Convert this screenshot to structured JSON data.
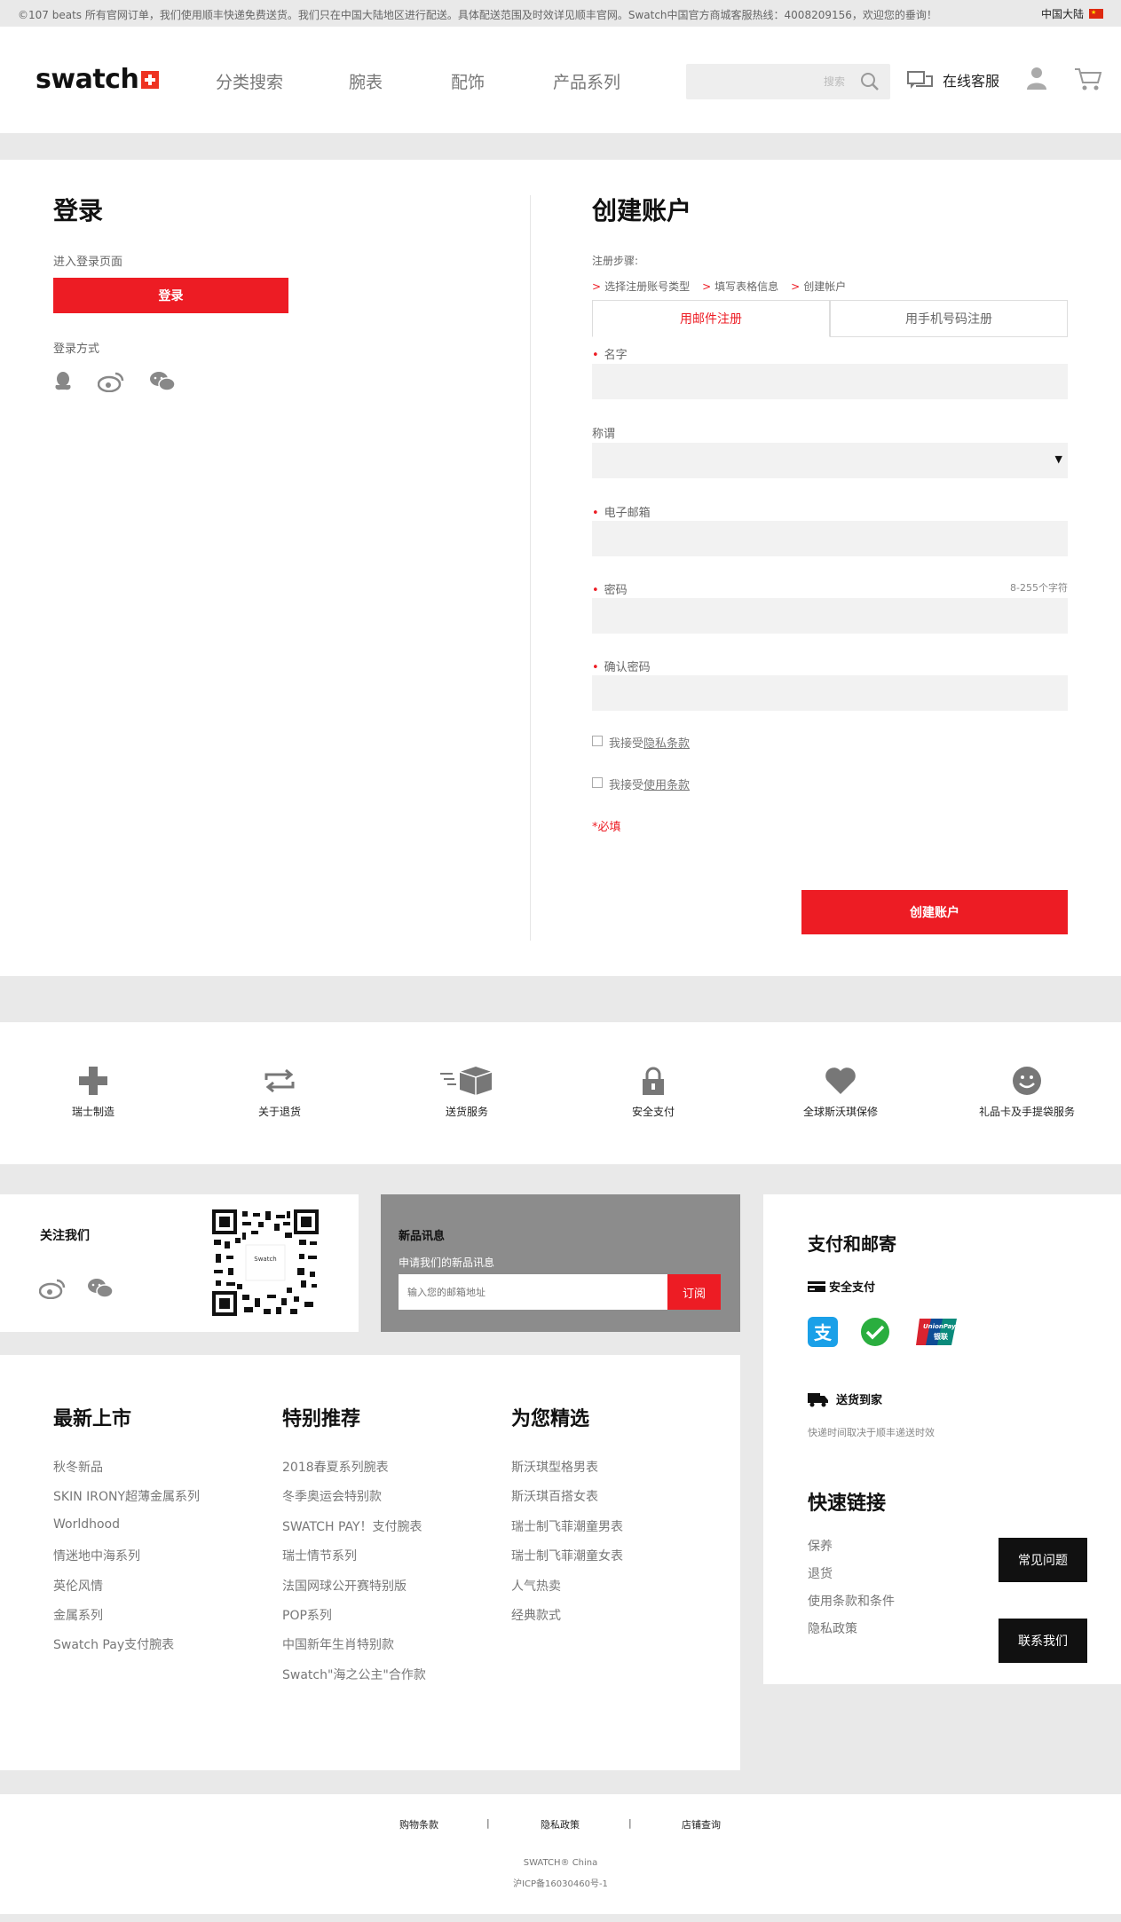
{
  "topbar": {
    "notice": "©107 beats 所有官网订单，我们使用顺丰快递免费送货。我们只在中国大陆地区进行配送。具体配送范围及时效详见顺丰官网。Swatch中国官方商城客服热线：4008209156，欢迎您的垂询！",
    "region": "中国大陆",
    "flag_color": "#de2910"
  },
  "header": {
    "logo": "swatch",
    "nav": [
      "分类搜索",
      "腕表",
      "配饰",
      "产品系列"
    ],
    "search_placeholder": "搜索",
    "service_label": "在线客服",
    "icons": [
      "search-icon",
      "chat-icon",
      "user-icon",
      "cart-icon"
    ]
  },
  "login": {
    "title": "登录",
    "enter_text": "进入登录页面",
    "login_button": "登录",
    "methods_label": "登录方式",
    "methods": [
      "qq-icon",
      "weibo-icon",
      "wechat-icon"
    ]
  },
  "register": {
    "title": "创建账户",
    "steps_label": "注册步骤:",
    "steps": [
      "选择注册账号类型",
      "填写表格信息",
      "创建帐户"
    ],
    "tabs": [
      "用邮件注册",
      "用手机号码注册"
    ],
    "active_tab": 0,
    "fields": {
      "name_label": "名字",
      "salutation_label": "称谓",
      "email_label": "电子邮箱",
      "password_label": "密码",
      "password_hint": "8-255个字符",
      "confirm_label": "确认密码"
    },
    "agree_prefix": "我接受",
    "privacy_link": "隐私条款",
    "terms_link": "使用条款",
    "required_note": "*必填",
    "submit_button": "创建账户"
  },
  "services": [
    {
      "icon": "cross-icon",
      "label": "瑞士制造"
    },
    {
      "icon": "return-icon",
      "label": "关于退货"
    },
    {
      "icon": "package-icon",
      "label": "送货服务"
    },
    {
      "icon": "lock-icon",
      "label": "安全支付"
    },
    {
      "icon": "heart-icon",
      "label": "全球斯沃琪保修"
    },
    {
      "icon": "smile-icon",
      "label": "礼品卡及手提袋服务"
    }
  ],
  "follow": {
    "title": "关注我们",
    "qr_label": "Swatch"
  },
  "newsletter": {
    "title": "新品讯息",
    "subtitle": "申请我们的新品讯息",
    "placeholder": "输入您的邮箱地址",
    "button": "订阅"
  },
  "payment": {
    "title": "支付和邮寄",
    "secure_label": "安全支付",
    "methods": [
      "alipay-icon",
      "wechat-pay-icon",
      "unionpay-icon"
    ],
    "unionpay_text": "UnionPay",
    "unionpay_cn": "银联",
    "delivery_label": "送货到家",
    "delivery_note": "快递时间取决于顺丰递送时效"
  },
  "quick_links": {
    "title": "快速链接",
    "items": [
      "保养",
      "退货",
      "使用条款和条件",
      "隐私政策"
    ],
    "faq_button": "常见问题",
    "contact_button": "联系我们"
  },
  "link_columns": [
    {
      "title": "最新上市",
      "items": [
        "秋冬新品",
        "SKIN IRONY超薄金属系列",
        "Worldhood",
        "情迷地中海系列",
        "英伦风情",
        "金属系列",
        "Swatch Pay支付腕表"
      ]
    },
    {
      "title": "特别推荐",
      "items": [
        "2018春夏系列腕表",
        "冬季奥运会特别款",
        "SWATCH PAY！支付腕表",
        "瑞士情节系列",
        "法国网球公开赛特别版",
        "POP系列",
        "中国新年生肖特别款",
        "Swatch\"海之公主\"合作款"
      ]
    },
    {
      "title": "为您精选",
      "items": [
        "斯沃琪型格男表",
        "斯沃琪百搭女表",
        "瑞士制飞菲潮童男表",
        "瑞士制飞菲潮童女表",
        "人气热卖",
        "经典款式"
      ]
    }
  ],
  "footer": {
    "links": [
      "购物条款",
      "隐私政策",
      "店铺查询"
    ],
    "separator": "|",
    "brand": "SWATCH® China",
    "icp": "沪ICP备16030460号-1"
  },
  "colors": {
    "accent": "#ed1c24",
    "icon_gray": "#888888",
    "dark": "#111111"
  }
}
